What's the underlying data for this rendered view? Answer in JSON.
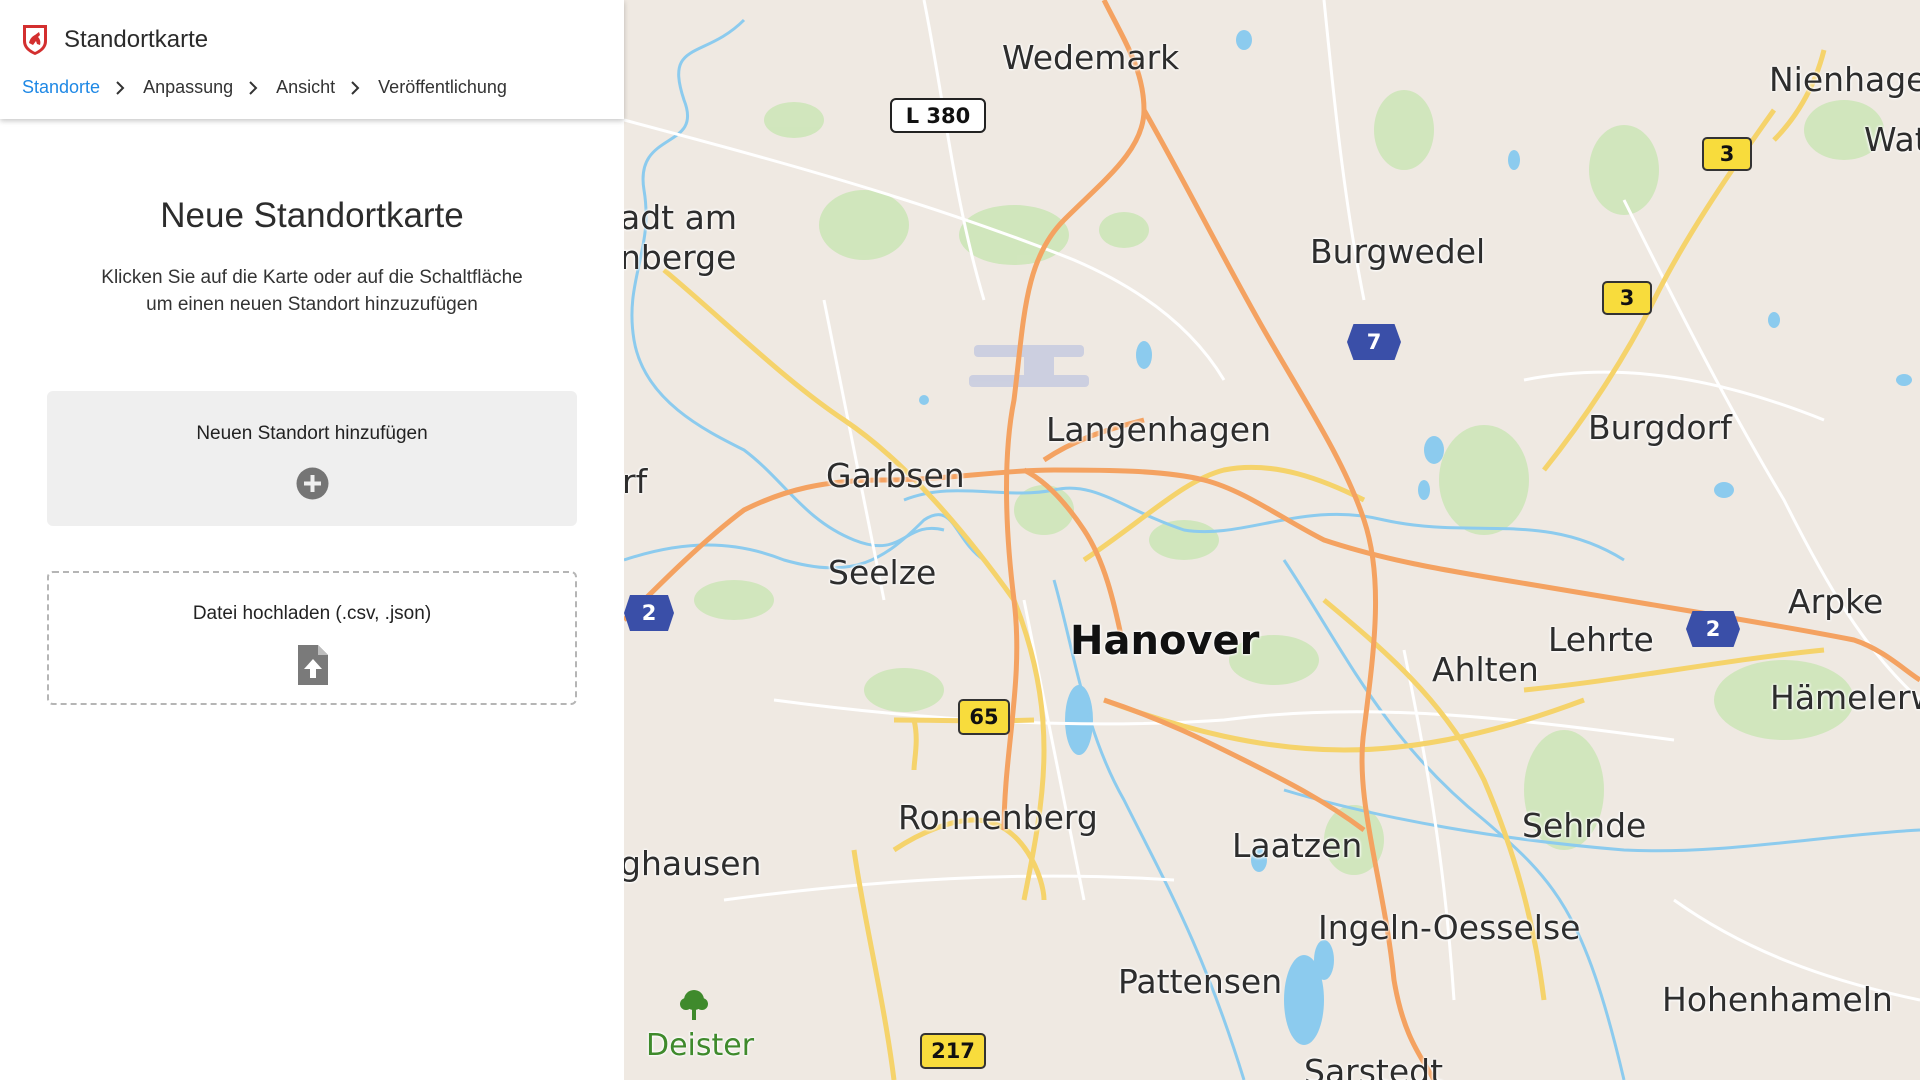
{
  "app": {
    "title": "Standortkarte",
    "logo": "coat-of-arms-logo"
  },
  "breadcrumb": {
    "items": [
      {
        "label": "Standorte",
        "active": true
      },
      {
        "label": "Anpassung",
        "active": false
      },
      {
        "label": "Ansicht",
        "active": false
      },
      {
        "label": "Veröffentlichung",
        "active": false
      }
    ],
    "separator_icon": "chevron-right-icon"
  },
  "main": {
    "title": "Neue Standortkarte",
    "description_line1": "Klicken Sie auf die Karte oder auf die Schaltfläche",
    "description_line2": "um einen neuen Standort hinzuzufügen"
  },
  "add_location": {
    "label": "Neuen Standort hinzufügen",
    "icon": "plus-circle-icon"
  },
  "upload": {
    "label": "Datei hochladen (.csv, .json)",
    "icon": "file-upload-icon"
  },
  "map": {
    "places": {
      "wedemark": "Wedemark",
      "nienhagen": "Nienhagen",
      "wath": "Wath",
      "stadt_am_1": "adt am",
      "stadt_am_2": "nberge",
      "burgwedel": "Burgwedel",
      "langenhagen": "Langenhagen",
      "garbsen": "Garbsen",
      "burgdorf": "Burgdorf",
      "rf": "rf",
      "seelze": "Seelze",
      "hanover": "Hanover",
      "arpke": "Arpke",
      "lehrte": "Lehrte",
      "ahlten": "Ahlten",
      "haemelerw": "Hämelerw",
      "ronnenberg": "Ronnenberg",
      "ghausen": "ghausen",
      "laatzen": "Laatzen",
      "sehnde": "Sehnde",
      "ingeln": "Ingeln-Oesselse",
      "pattensen": "Pattensen",
      "hohenhameln": "Hohenhameln",
      "deister": "Deister",
      "sarstedt": "Sarstedt"
    },
    "shields": {
      "l380": "L 380",
      "b3_top": "3",
      "b3_mid": "3",
      "a7": "7",
      "a2_left": "2",
      "a2_right": "2",
      "b65": "65",
      "b217": "217"
    },
    "colors": {
      "land": "#efe9e2",
      "forest": "#c9e3b0",
      "water": "#8ccbee",
      "motorway": "#f4a261",
      "primary": "#f5d36b"
    }
  }
}
